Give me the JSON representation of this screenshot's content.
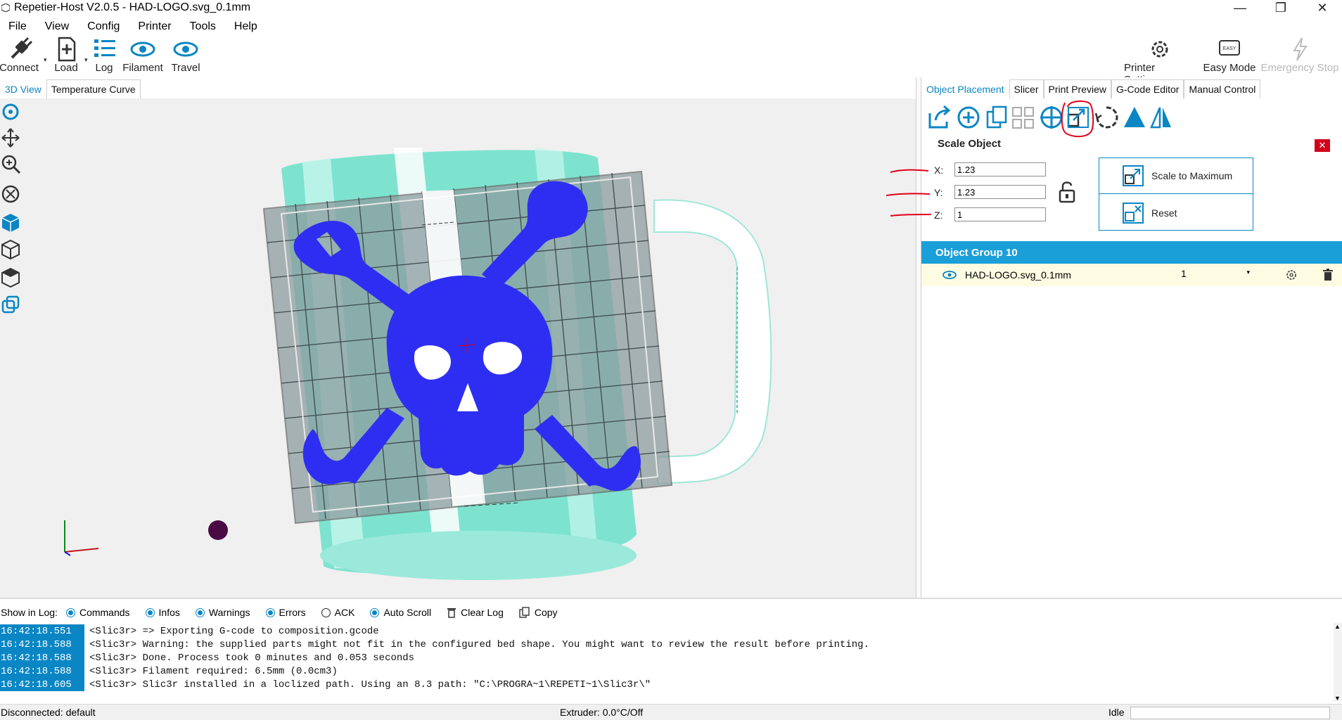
{
  "window": {
    "title": "Repetier-Host V2.0.5 - HAD-LOGO.svg_0.1mm"
  },
  "menu": [
    "File",
    "View",
    "Config",
    "Printer",
    "Tools",
    "Help"
  ],
  "toolbar": {
    "connect": "Connect",
    "load": "Load",
    "log": "Log",
    "filament": "Filament",
    "travel": "Travel",
    "printer_settings": "Printer Settings",
    "easy_mode": "Easy Mode",
    "easy_badge": "EASY",
    "emergency_stop": "Emergency Stop"
  },
  "left_tabs": [
    "3D View",
    "Temperature Curve"
  ],
  "right_tabs": [
    "Object Placement",
    "Slicer",
    "Print Preview",
    "G-Code Editor",
    "Manual Control"
  ],
  "scale_panel": {
    "title": "Scale Object",
    "x_label": "X:",
    "x_value": "1.23",
    "y_label": "Y:",
    "y_value": "1.23",
    "z_label": "Z:",
    "z_value": "1",
    "scale_max": "Scale to Maximum",
    "reset": "Reset",
    "close": "✕"
  },
  "object_group": {
    "name": "Object Group 10",
    "objects": [
      {
        "name": "HAD-LOGO.svg_0.1mm",
        "copies": "1"
      }
    ]
  },
  "log_bar": {
    "show_in_log": "Show in Log:",
    "commands": "Commands",
    "infos": "Infos",
    "warnings": "Warnings",
    "errors": "Errors",
    "ack": "ACK",
    "auto_scroll": "Auto Scroll",
    "clear_log": "Clear Log",
    "copy": "Copy"
  },
  "log": [
    {
      "time": "16:42:18.551",
      "msg": "<Slic3r> => Exporting G-code to composition.gcode"
    },
    {
      "time": "16:42:18.588",
      "msg": "<Slic3r> Warning: the supplied parts might not fit in the configured bed shape. You might want to review the result before printing."
    },
    {
      "time": "16:42:18.588",
      "msg": "<Slic3r> Done. Process took 0 minutes and 0.053 seconds"
    },
    {
      "time": "16:42:18.588",
      "msg": "<Slic3r> Filament required: 6.5mm (0.0cm3)"
    },
    {
      "time": "16:42:18.605",
      "msg": "<Slic3r> Slic3r installed in a loclized path. Using an 8.3 path: \"C:\\PROGRA~1\\REPETI~1\\Slic3r\\\""
    }
  ],
  "status": {
    "connection": "Disconnected: default",
    "extruder": "Extruder: 0.0°C/Off",
    "state": "Idle"
  },
  "colors": {
    "accent": "#0a86c4",
    "group_header": "#1a9fd9",
    "logo": "#2e2ef2",
    "mug": "#7de3cf",
    "annotation": "#e0001b"
  },
  "icons": [
    "app-icon",
    "connect-plug-icon",
    "load-plus-icon",
    "log-list-icon",
    "filament-eye-icon",
    "travel-eye-icon",
    "printer-settings-gear-icon",
    "easy-mode-icon",
    "emergency-lightning-icon"
  ]
}
